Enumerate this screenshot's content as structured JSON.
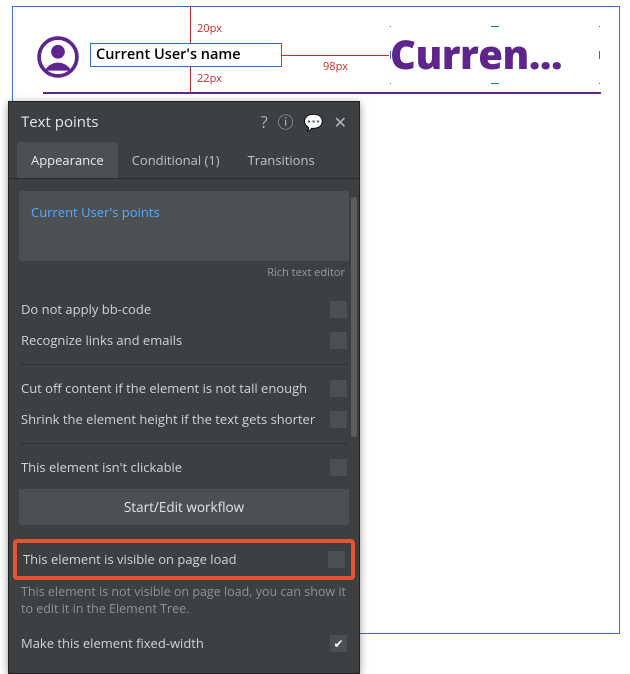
{
  "canvas": {
    "name_field_text": "Current User's name",
    "selected_text": "Curren...",
    "measurements": {
      "top_gap": "20px",
      "bottom_gap": "22px",
      "horizontal_gap": "98px"
    }
  },
  "panel": {
    "title": "Text points",
    "tabs": {
      "appearance": "Appearance",
      "conditional": "Conditional (1)",
      "transitions": "Transitions"
    },
    "appearance": {
      "expression": "Current User's points",
      "rich_text_caption": "Rich text editor",
      "rows": {
        "no_bbcode": "Do not apply bb-code",
        "recognize_links": "Recognize links and emails",
        "cut_off": "Cut off content if the element is not tall enough",
        "shrink": "Shrink the element height if the text gets shorter",
        "not_clickable": "This element isn't clickable",
        "workflow_button": "Start/Edit workflow",
        "visible_on_load": "This element is visible on page load",
        "visible_helper": "This element is not visible on page load, you can show it to edit it in the Element Tree.",
        "fixed_width": "Make this element fixed-width"
      }
    }
  }
}
